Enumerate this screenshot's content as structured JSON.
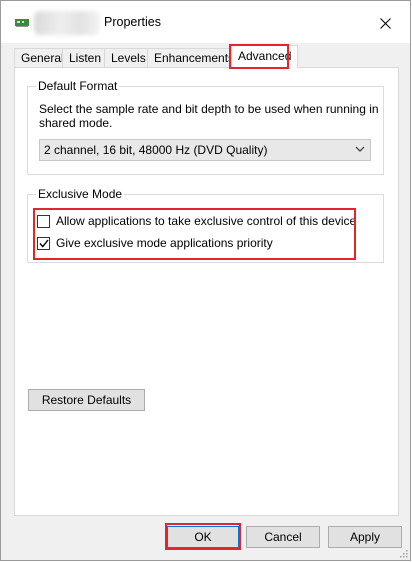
{
  "window": {
    "title": "Properties",
    "close_icon": "close-icon",
    "app_icon": "sound-card-icon"
  },
  "tabs": [
    {
      "label": "General",
      "active": false
    },
    {
      "label": "Listen",
      "active": false
    },
    {
      "label": "Levels",
      "active": false
    },
    {
      "label": "Enhancements",
      "active": false
    },
    {
      "label": "Advanced",
      "active": true
    }
  ],
  "default_format": {
    "group_label": "Default Format",
    "description": "Select the sample rate and bit depth to be used when running in shared mode.",
    "selected": "2 channel, 16 bit, 48000 Hz (DVD Quality)"
  },
  "exclusive_mode": {
    "group_label": "Exclusive Mode",
    "options": [
      {
        "label": "Allow applications to take exclusive control of this device",
        "checked": false
      },
      {
        "label": "Give exclusive mode applications priority",
        "checked": true
      }
    ]
  },
  "restore_defaults_label": "Restore Defaults",
  "footer": {
    "ok_label": "OK",
    "cancel_label": "Cancel",
    "apply_label": "Apply"
  },
  "colors": {
    "highlight": "#e2262a",
    "default_button_border": "#0078d7"
  }
}
